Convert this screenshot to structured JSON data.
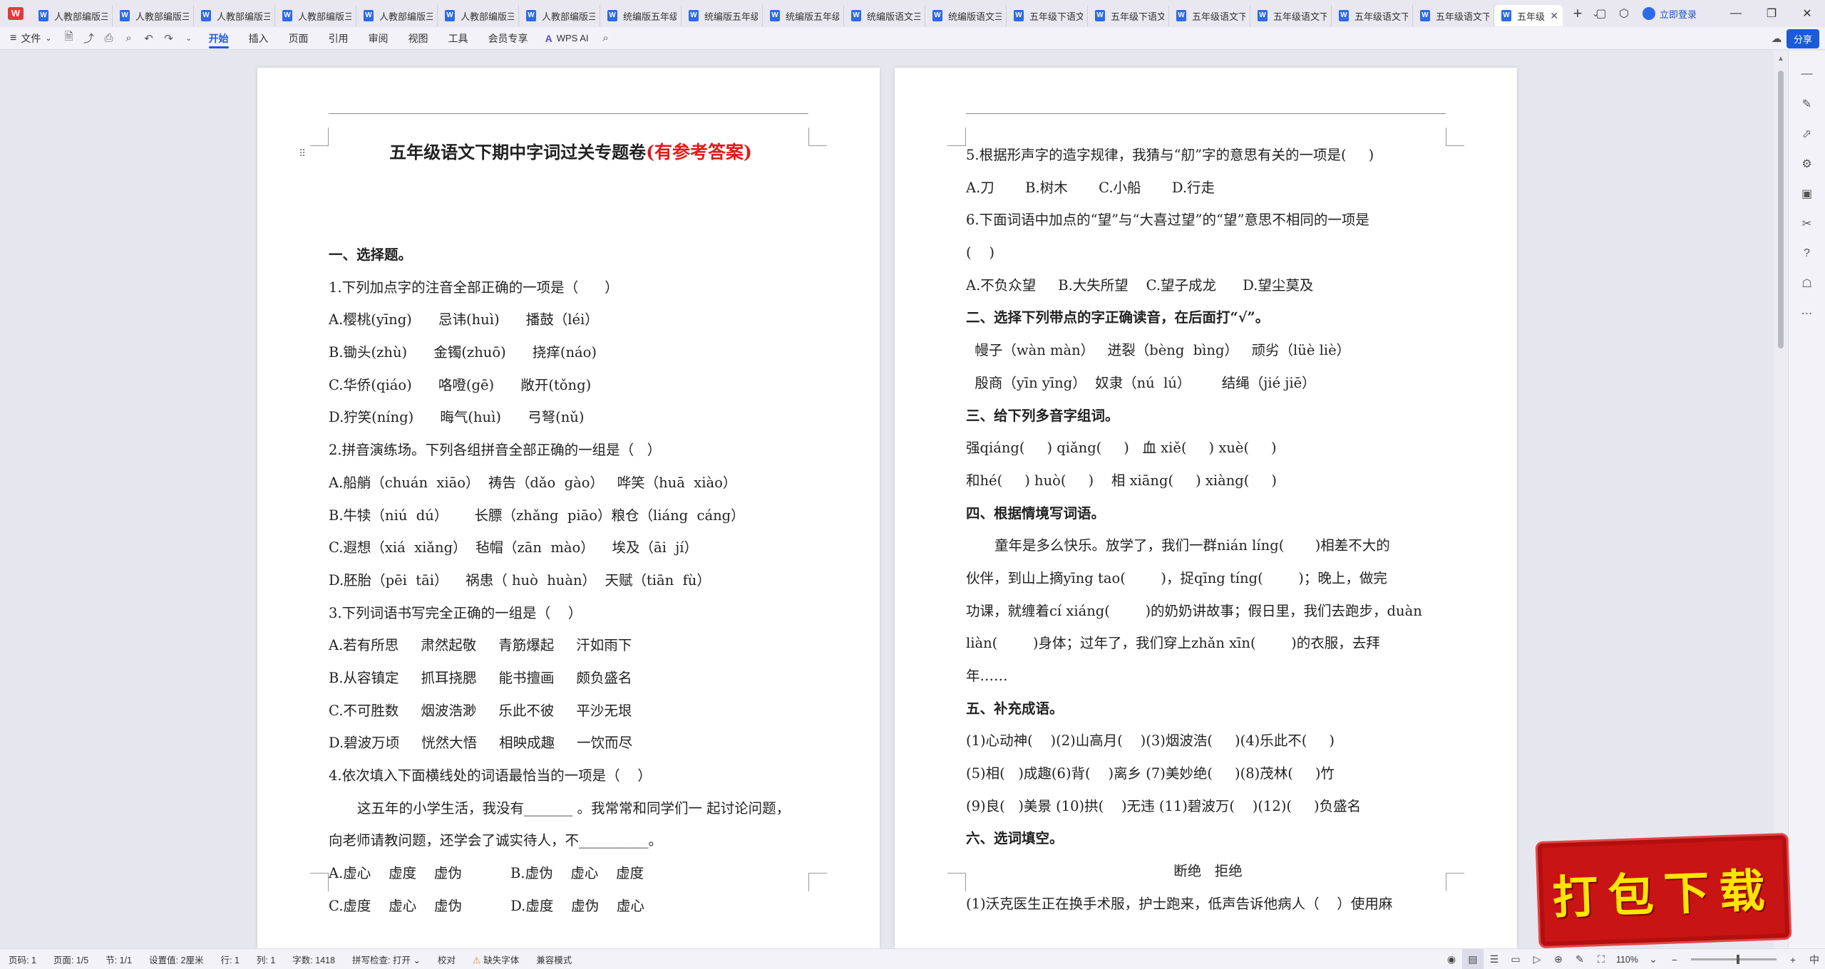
{
  "tabbar": {
    "tabs": [
      {
        "label": "人教部编版三"
      },
      {
        "label": "人教部编版三"
      },
      {
        "label": "人教部编版三"
      },
      {
        "label": "人教部编版三"
      },
      {
        "label": "人教部编版三"
      },
      {
        "label": "人教部编版三"
      },
      {
        "label": "人教部编版三"
      },
      {
        "label": "统编版五年级"
      },
      {
        "label": "统编版五年级"
      },
      {
        "label": "统编版五年级"
      },
      {
        "label": "统编版语文三"
      },
      {
        "label": "统编版语文三"
      },
      {
        "label": "五年级下语文"
      },
      {
        "label": "五年级下语文"
      },
      {
        "label": "五年级语文下"
      },
      {
        "label": "五年级语文下"
      },
      {
        "label": "五年级语文下"
      },
      {
        "label": "五年级语文下"
      }
    ],
    "active_tab": {
      "label": "五年级"
    },
    "login_label": "立即登录"
  },
  "menubar": {
    "file_label": "文件",
    "items": [
      "开始",
      "插入",
      "页面",
      "引用",
      "审阅",
      "视图",
      "工具",
      "会员专享"
    ],
    "ai_label": "WPS AI",
    "share_label": "分享"
  },
  "document": {
    "title_main": "五年级语文下期中字词过关专题卷",
    "title_red": "(有参考答案)",
    "left_lines": [
      {
        "text": "一、选择题。",
        "bold": true
      },
      {
        "text": "1.下列加点字的注音全部正确的一项是（      ）"
      },
      {
        "text": "A.樱桃(yīng)      忌讳(huì)      播鼓（léi）"
      },
      {
        "text": "B.锄头(zhù)      金镯(zhuō)      挠痒(náo)"
      },
      {
        "text": "C.华侨(qiáo)      咯噔(gē)      敞开(tǒng)"
      },
      {
        "text": "D.狞笑(níng)      晦气(huì)      弓弩(nǔ)"
      },
      {
        "text": "2.拼音演练场。下列各组拼音全部正确的一组是（   ）"
      },
      {
        "text": "A.船艄（chuán  xiāo）  祷告（dǎo  gào）   哗笑（huā  xiào）"
      },
      {
        "text": "B.牛犊（niú  dú）      长膘（zhǎng  piāo）粮仓（liáng  cáng）"
      },
      {
        "text": "C.遐想（xiá  xiǎng）  毡帽（zān  mào）    埃及（āi  jí）"
      },
      {
        "text": "D.胚胎（pēi  tāi）    祸患（ huò  huàn）  天赋（tiān  fù）"
      },
      {
        "text": "3.下列词语书写完全正确的一组是（    ）"
      },
      {
        "text": "A.若有所思     肃然起敬     青筋爆起     汗如雨下"
      },
      {
        "text": "B.从容镇定     抓耳挠腮     能书擅画     颇负盛名"
      },
      {
        "text": "C.不可胜数     烟波浩渺     乐此不彼     平沙无垠"
      },
      {
        "text": "D.碧波万顷     恍然大悟     相映成趣     一饮而尽"
      },
      {
        "text": "4.依次填入下面横线处的词语最恰当的一项是（    ）"
      },
      {
        "text": "这五年的小学生活，我没有_______ 。我常常和同学们一 起讨论问题，",
        "indent": true
      },
      {
        "text": "向老师请教问题，还学会了诚实待人，不__________。"
      },
      {
        "text": "A.虚心    虚度    虚伪           B.虚伪    虚心    虚度"
      },
      {
        "text": "C.虚度    虚心    虚伪           D.虚度    虚伪    虚心"
      }
    ],
    "right_lines": [
      {
        "text": "5.根据形声字的造字规律，我猜与“舠”字的意思有关的一项是(     )"
      },
      {
        "text": "A.刀       B.树木       C.小船       D.行走"
      },
      {
        "text": "6.下面词语中加点的“望”与“大喜过望”的“望”意思不相同的一项是"
      },
      {
        "text": "(    )"
      },
      {
        "text": "A.不负众望     B.大失所望    C.望子成龙      D.望尘莫及"
      },
      {
        "text": "二、选择下列带点的字正确读音，在后面打“√”。",
        "bold": true
      },
      {
        "text": "  幔子（wàn màn）   迸裂（bèng  bìng）   顽劣（lüè liè）"
      },
      {
        "text": "  殷商（yīn yīng）  奴隶（nú  lú）       结绳（jié jiē）"
      },
      {
        "text": "三、给下列多音字组词。",
        "bold": true
      },
      {
        "text": "强qiáng(     ) qiǎng(     )   血 xiě(     ) xuè(     )"
      },
      {
        "text": "和hé(     ) huò(     )    相 xiāng(     ) xiàng(     )"
      },
      {
        "text": "四、根据情境写词语。",
        "bold": true
      },
      {
        "text": "童年是多么快乐。放学了，我们一群nián líng(       )相差不大的",
        "indent": true
      },
      {
        "text": "伙伴，到山上摘yīng tao(        )，捉qīng tíng(        )；晚上，做完"
      },
      {
        "text": "功课，就缠着cí xiáng(        )的奶奶讲故事；假日里，我们去跑步，duàn"
      },
      {
        "text": "liàn(        )身体；过年了，我们穿上zhǎn xīn(        )的衣服，去拜"
      },
      {
        "text": "年……"
      },
      {
        "text": "五、补充成语。",
        "bold": true
      },
      {
        "text": "(1)心动神(    )(2)山高月(    )(3)烟波浩(     )(4)乐此不(     )"
      },
      {
        "text": "(5)相(   )成趣(6)背(    )离乡 (7)美妙绝(     )(8)茂林(     )竹"
      },
      {
        "text": "(9)良(   )美景 (10)拱(    )无违 (11)碧波万(    )(12)(     )负盛名"
      },
      {
        "text": "六、选词填空。",
        "bold": true
      },
      {
        "text": "断绝   拒绝",
        "center": true
      },
      {
        "text": "(1)沃克医生正在换手术服，护士跑来，低声告诉他病人（    ）使用麻"
      }
    ]
  },
  "statusbar": {
    "page_no": "页码: 1",
    "page_of": "页面: 1/5",
    "section": "节: 1/1",
    "setting": "设置值: 2厘米",
    "row": "行: 1",
    "col": "列: 1",
    "words": "字数: 1418",
    "spell": "拼写检查: 打开",
    "proof": "校对",
    "missing_font": "缺失字体",
    "compat": "兼容模式",
    "zoom": "110%",
    "zoom_level": 0.55
  },
  "banner": {
    "text": "打包下载"
  }
}
